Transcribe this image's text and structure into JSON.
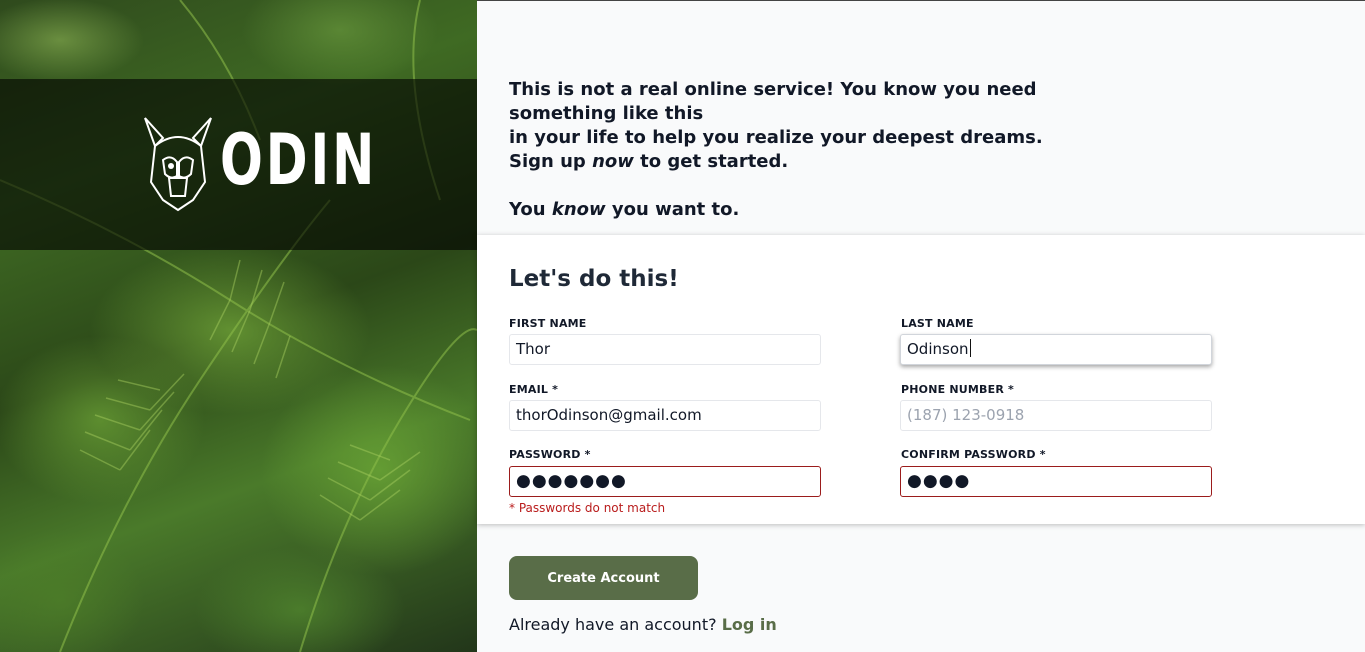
{
  "brand": {
    "name": "ODIN",
    "logo_icon": "viking-helmet-icon"
  },
  "intro": {
    "line1": "This is not a real online service! You know you need something like this",
    "line2": "in your life to help you realize your deepest dreams.",
    "line3_before": "Sign up ",
    "line3_em": "now",
    "line3_after": " to get started.",
    "line4_before": "You ",
    "line4_em": "know",
    "line4_after": " you want to."
  },
  "form": {
    "title": "Let's do this!",
    "first_name": {
      "label": "FIRST NAME",
      "value": "Thor"
    },
    "last_name": {
      "label": "LAST NAME",
      "value": "Odinson"
    },
    "email": {
      "label": "EMAIL *",
      "value": "thorOdinson@gmail.com"
    },
    "phone": {
      "label": "PHONE NUMBER *",
      "value": "",
      "placeholder": "(187) 123-0918"
    },
    "password": {
      "label": "PASSWORD *",
      "masked_value": "●●●●●●●"
    },
    "confirm_password": {
      "label": "CONFIRM PASSWORD *",
      "masked_value": "●●●●"
    },
    "error": "* Passwords do not match",
    "submit_label": "Create Account",
    "login_prompt": "Already have an account?",
    "login_link": "Log in"
  },
  "colors": {
    "accent": "#596d48",
    "error": "#b91c1c",
    "background": "#f9fafb"
  }
}
